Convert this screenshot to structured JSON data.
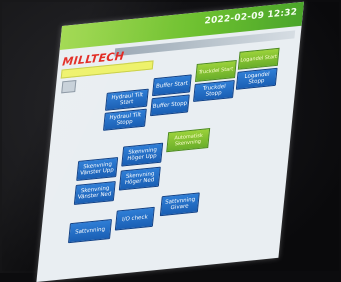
{
  "header": {
    "datetime": "2022-02-09 12:32",
    "logo": "MILLTECH"
  },
  "buttons": {
    "hydraul_start": "Hydraul Tilt Start",
    "hydraul_stopp": "Hydraul Tilt Stopp",
    "buffer_start": "Buffer Start",
    "buffer_stopp": "Buffer Stopp",
    "truckdel_start": "Truckdel Start",
    "truckdel_stopp": "Truckdel Stopp",
    "logandel_start": "Logandel Start",
    "logandel_stopp": "Logandel Stopp",
    "skenvning_vanster_upp": "Skenvning Vänster Upp",
    "skenvning_hoger_upp": "Skenvning Höger Upp",
    "skenvning_vanster_ned": "Skenvning Vänster Ned",
    "skenvning_hoger_ned": "Skenvning Höger Ned",
    "automatisk_skenvning": "Automatisk Skenvning",
    "sattvnning": "Sattvnning",
    "io_check": "I/O check",
    "sattvnning_givare": "Sattvnning Givare"
  }
}
